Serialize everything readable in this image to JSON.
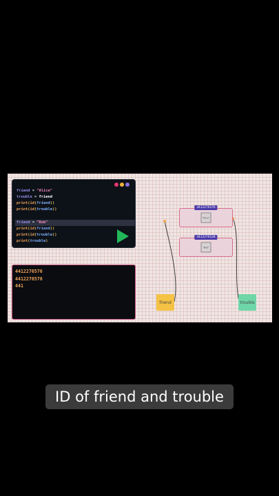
{
  "editor": {
    "window_dots": [
      "#e8366f",
      "#f0b23a",
      "#8a6fe0"
    ],
    "lines_block1": [
      {
        "parts": [
          [
            "friend",
            "v"
          ],
          [
            " = ",
            "op"
          ],
          [
            "\"Alice\"",
            "s"
          ]
        ]
      },
      {
        "parts": [
          [
            "trouble",
            "v"
          ],
          [
            " = ",
            "op"
          ],
          [
            "friend",
            "n"
          ]
        ]
      },
      {
        "parts": [
          [
            "print",
            "fn"
          ],
          [
            "(",
            "p"
          ],
          [
            "id",
            "id"
          ],
          [
            "(",
            "p"
          ],
          [
            "friend",
            "arg"
          ],
          [
            "))",
            "p"
          ]
        ]
      },
      {
        "parts": [
          [
            "print",
            "fn"
          ],
          [
            "(",
            "p"
          ],
          [
            "id",
            "id"
          ],
          [
            "(",
            "p"
          ],
          [
            "trouble",
            "arg"
          ],
          [
            "))",
            "p"
          ]
        ]
      }
    ],
    "lines_block2": [
      {
        "parts": [
          [
            "friend",
            "v"
          ],
          [
            " = ",
            "op"
          ],
          [
            "\"Bob\"",
            "s"
          ]
        ],
        "highlight": true
      },
      {
        "parts": [
          [
            "print",
            "fn"
          ],
          [
            "(",
            "p"
          ],
          [
            "id",
            "id"
          ],
          [
            "(",
            "p"
          ],
          [
            "friend",
            "arg"
          ],
          [
            "))",
            "p"
          ]
        ]
      },
      {
        "parts": [
          [
            "print",
            "fn"
          ],
          [
            "(",
            "p"
          ],
          [
            "id",
            "id"
          ],
          [
            "(",
            "p"
          ],
          [
            "trouble",
            "arg"
          ],
          [
            "))",
            "p"
          ]
        ]
      },
      {
        "parts": [
          [
            "print",
            "fn"
          ],
          [
            "(",
            "p"
          ],
          [
            "trouble",
            "arg"
          ],
          [
            ")",
            "p"
          ]
        ]
      }
    ],
    "run_color": "#22b85a"
  },
  "console": {
    "lines": [
      "4412276576",
      "4412276576",
      "441"
    ]
  },
  "memory": {
    "objects": [
      {
        "id_label": "4412276576",
        "value": "\"Alice\""
      },
      {
        "id_label": "4412276528",
        "value": "\"Bob\""
      }
    ],
    "variables": [
      {
        "name": "friend",
        "color": "#f6c244"
      },
      {
        "name": "trouble",
        "color": "#6fd6a8"
      }
    ]
  },
  "subtitle": "ID of friend and trouble"
}
